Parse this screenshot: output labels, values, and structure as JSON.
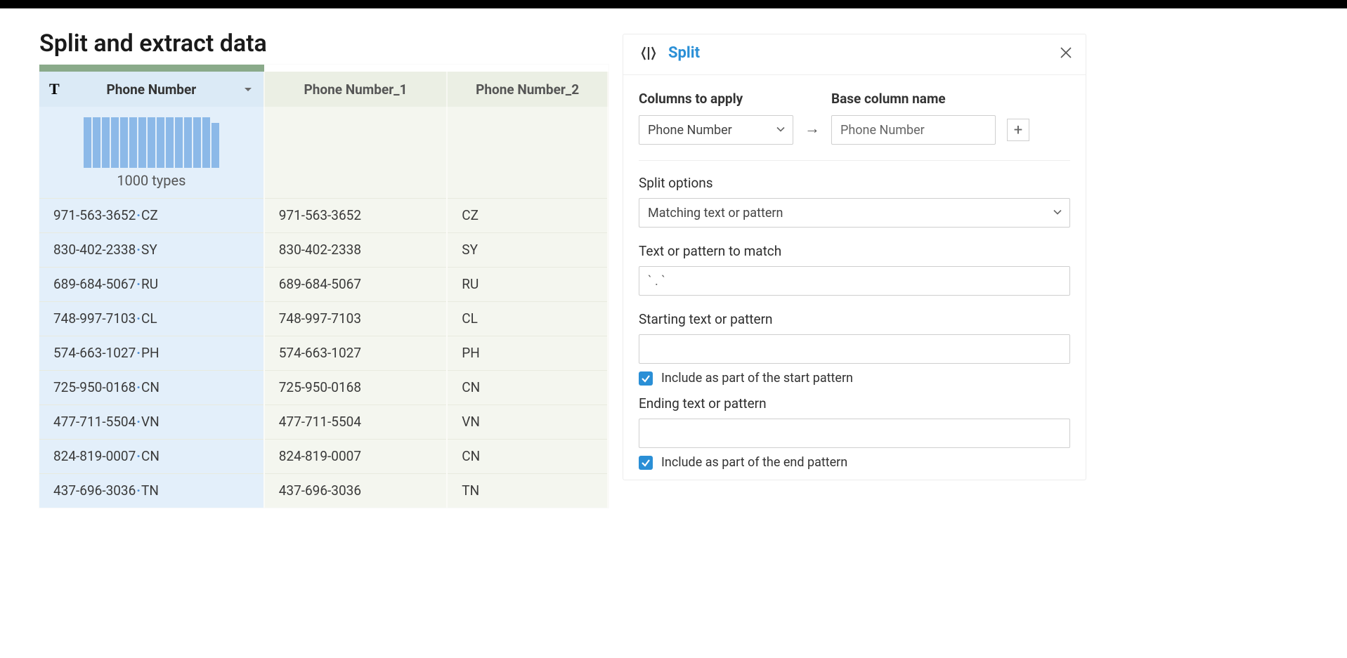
{
  "page_title": "Split and extract data",
  "table": {
    "columns": [
      {
        "label": "Phone Number",
        "selected": true
      },
      {
        "label": "Phone Number_1",
        "selected": false
      },
      {
        "label": "Phone Number_2",
        "selected": false
      }
    ],
    "profile_summary": "1000 types",
    "rows": [
      {
        "raw_phone": "971-563-3652",
        "raw_cc": "CZ",
        "c1": "971-563-3652",
        "c2": "CZ"
      },
      {
        "raw_phone": "830-402-2338",
        "raw_cc": "SY",
        "c1": "830-402-2338",
        "c2": "SY"
      },
      {
        "raw_phone": "689-684-5067",
        "raw_cc": "RU",
        "c1": "689-684-5067",
        "c2": "RU"
      },
      {
        "raw_phone": "748-997-7103",
        "raw_cc": "CL",
        "c1": "748-997-7103",
        "c2": "CL"
      },
      {
        "raw_phone": "574-663-1027",
        "raw_cc": "PH",
        "c1": "574-663-1027",
        "c2": "PH"
      },
      {
        "raw_phone": "725-950-0168",
        "raw_cc": "CN",
        "c1": "725-950-0168",
        "c2": "CN"
      },
      {
        "raw_phone": "477-711-5504",
        "raw_cc": "VN",
        "c1": "477-711-5504",
        "c2": "VN"
      },
      {
        "raw_phone": "824-819-0007",
        "raw_cc": "CN",
        "c1": "824-819-0007",
        "c2": "CN"
      },
      {
        "raw_phone": "437-696-3036",
        "raw_cc": "TN",
        "c1": "437-696-3036",
        "c2": "TN"
      }
    ]
  },
  "panel": {
    "title": "Split",
    "columns_to_apply_label": "Columns to apply",
    "columns_to_apply_value": "Phone Number",
    "base_column_name_label": "Base column name",
    "base_column_name_value": "Phone Number",
    "split_options_label": "Split options",
    "split_options_value": "Matching text or pattern",
    "text_pattern_label": "Text or pattern to match",
    "text_pattern_value": "` . `",
    "starting_pattern_label": "Starting text or pattern",
    "starting_pattern_value": "",
    "include_start_label": "Include as part of the start pattern",
    "ending_pattern_label": "Ending text or pattern",
    "ending_pattern_value": "",
    "include_end_label": "Include as part of the end pattern"
  }
}
